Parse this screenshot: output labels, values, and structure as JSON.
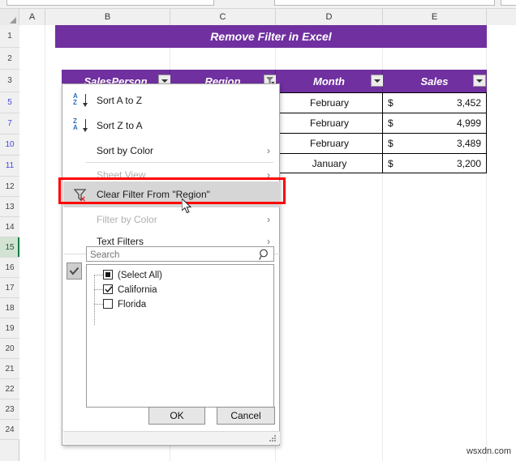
{
  "app": {
    "watermark": "wsxdn.com"
  },
  "sheet": {
    "columns": [
      "A",
      "B",
      "C",
      "D",
      "E"
    ],
    "rows": [
      "1",
      "2",
      "3",
      "5",
      "7",
      "10",
      "11",
      "12",
      "13",
      "14",
      "15",
      "16",
      "17",
      "18",
      "19",
      "20",
      "21",
      "22",
      "23",
      "24"
    ],
    "filtered_rows": [
      "5",
      "7",
      "10",
      "11"
    ],
    "selected_row": "15",
    "banner_title": "Remove Filter in Excel",
    "accent_color": "#7030a0"
  },
  "table": {
    "headers": [
      "SalesPerson",
      "Region",
      "Month",
      "Sales"
    ],
    "region_filter_active": true,
    "rows": [
      {
        "month": "February",
        "currency": "$",
        "sales": "3,452"
      },
      {
        "month": "February",
        "currency": "$",
        "sales": "4,999"
      },
      {
        "month": "February",
        "currency": "$",
        "sales": "3,489"
      },
      {
        "month": "January",
        "currency": "$",
        "sales": "3,200"
      }
    ]
  },
  "filter_menu": {
    "items": [
      {
        "label": "Sort A to Z",
        "icon": "sort-az-icon",
        "disabled": false,
        "submenu": false
      },
      {
        "label": "Sort Z to A",
        "icon": "sort-za-icon",
        "disabled": false,
        "submenu": false
      },
      {
        "label": "Sort by Color",
        "icon": "none",
        "disabled": false,
        "submenu": true
      },
      {
        "label": "Sheet View",
        "icon": "none",
        "disabled": true,
        "submenu": true
      },
      {
        "label": "Clear Filter From \"Region\"",
        "icon": "clear-filter-icon",
        "disabled": false,
        "submenu": false
      },
      {
        "label": "Filter by Color",
        "icon": "none",
        "disabled": true,
        "submenu": true
      },
      {
        "label": "Text Filters",
        "icon": "none",
        "disabled": false,
        "submenu": true
      }
    ],
    "highlighted_item": "Clear Filter From \"Region\"",
    "highlight_color": "#ff0000",
    "search": {
      "placeholder": "Search",
      "value": ""
    },
    "checklist": [
      {
        "label": "(Select All)",
        "state": "indeterminate"
      },
      {
        "label": "California",
        "state": "checked"
      },
      {
        "label": "Florida",
        "state": "unchecked"
      }
    ],
    "ok_label": "OK",
    "cancel_label": "Cancel"
  }
}
